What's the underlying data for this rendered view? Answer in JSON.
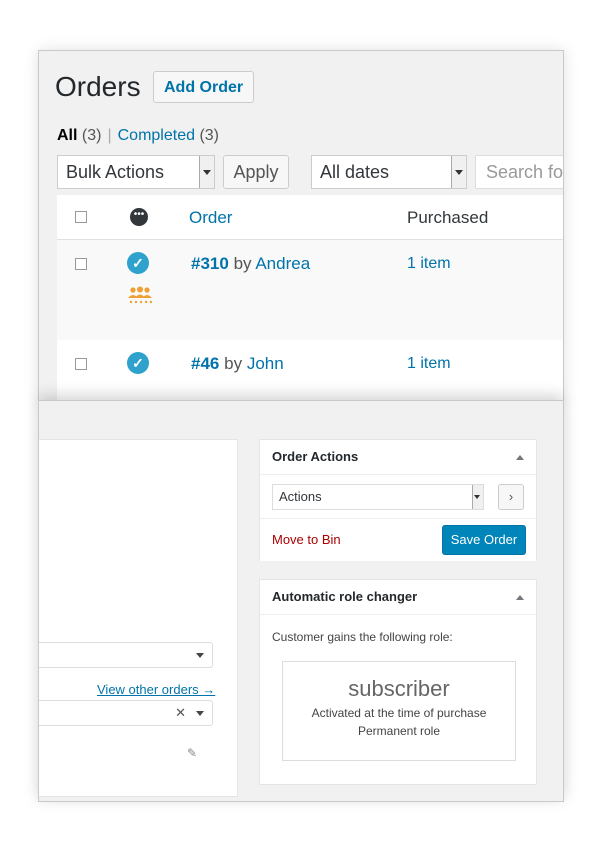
{
  "orders_page": {
    "title": "Orders",
    "add_order_label": "Add Order",
    "filters": [
      {
        "label": "All",
        "count": "(3)",
        "current": true
      },
      {
        "label": "Completed",
        "count": "(3)",
        "current": false
      }
    ],
    "filter_separator": "|",
    "bulk_actions": {
      "selected": "Bulk Actions"
    },
    "apply_label": "Apply",
    "dates_filter": {
      "selected": "All dates"
    },
    "search": {
      "placeholder": "Search fo"
    },
    "table": {
      "columns": {
        "status_icon": "ellipsis-icon",
        "order": "Order",
        "purchased": "Purchased"
      },
      "rows": [
        {
          "order_number": "#310",
          "by": "by",
          "customer": "Andrea",
          "purchased": "1 item",
          "status": "completed",
          "role_icon": "group-icon"
        },
        {
          "order_number": "#46",
          "by": "by",
          "customer": "John",
          "purchased": "1 item",
          "status": "completed"
        }
      ]
    }
  },
  "edit_order": {
    "view_other_orders": "View other orders →",
    "order_actions": {
      "title": "Order Actions",
      "action_select": {
        "selected": "Actions"
      },
      "go_label": "›",
      "move_to_bin": "Move to Bin",
      "save_order": "Save Order"
    },
    "role_changer": {
      "title": "Automatic role changer",
      "description": "Customer gains the following role:",
      "role": "subscriber",
      "line1": "Activated at the time of purchase",
      "line2": "Permanent role"
    }
  },
  "colors": {
    "link": "#0073aa",
    "primary_button": "#0085ba",
    "danger": "#aa0000",
    "status_check": "#2ea2cc",
    "role_icon": "#f0a033"
  }
}
